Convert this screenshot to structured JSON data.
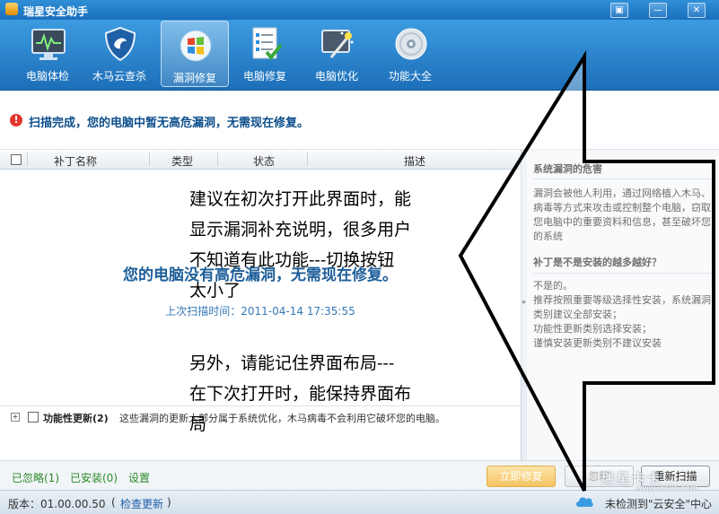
{
  "window": {
    "title": "瑞星安全助手",
    "controls": [
      "▣",
      "—",
      "✕"
    ]
  },
  "toolbar": {
    "items": [
      {
        "label": "电脑体检",
        "icon": "monitor-check-icon"
      },
      {
        "label": "木马云查杀",
        "icon": "shield-icon"
      },
      {
        "label": "漏洞修复",
        "icon": "windows-icon",
        "active": true
      },
      {
        "label": "电脑修复",
        "icon": "checklist-icon"
      },
      {
        "label": "电脑优化",
        "icon": "magic-wand-icon"
      },
      {
        "label": "功能大全",
        "icon": "disc-icon"
      }
    ]
  },
  "notice": {
    "text": "扫描完成，您的电脑中暂无高危漏洞，无需现在修复。"
  },
  "table": {
    "headers": [
      "补丁名称",
      "类型",
      "状态",
      "描述"
    ],
    "empty_message": "您的电脑没有高危漏洞，无需现在修复。",
    "last_scan": "上次扫描时间：2011-04-14 17:35:55"
  },
  "functional_row": {
    "name": "功能性更新(2)",
    "desc": "这些漏洞的更新大部分属于系统优化，木马病毒不会利用它破坏您的电脑。"
  },
  "side_panel": {
    "heading1": "系统漏洞的危害",
    "para1": "漏洞会被他人利用，通过网络植入木马、病毒等方式来攻击或控制整个电脑，窃取您电脑中的重要资料和信息，甚至破坏您的系统",
    "heading2": "补丁是不是安装的越多越好？",
    "answer": "不是的。",
    "lines": [
      "推荐按照重要等级选择性安装，系统漏洞类别建议全部安装；",
      "功能性更新类别选择安装；",
      "谨慎安装更新类别不建议安装"
    ]
  },
  "bottom": {
    "ignored": "已忽略(1)",
    "installed": "已安装(0)",
    "settings": "设置",
    "fix_button": "立即修复",
    "ignore_button": "忽略",
    "rescan_button": "重新扫描"
  },
  "status": {
    "version": "版本：01.00.00.50",
    "check_update": "检查更新",
    "paren_open": "(",
    "paren_close": ")",
    "cloud_text": "未检测到\"云安全\"中心"
  },
  "watermark": {
    "brand": "瑞星卡卡",
    "url": "www.ikaka.com"
  },
  "annotation": {
    "lines1": [
      "建议在初次打开此界面时，能",
      "显示漏洞补充说明，很多用户",
      "不知道有此功能---切换按钮",
      "太小了"
    ],
    "lines2": [
      "另外，请能记住界面布局---",
      "在下次打开时，能保持界面布",
      "局"
    ]
  },
  "colors": {
    "accent": "#1c6fb8",
    "warning": "#e2352b",
    "link_green": "#2c8a2c"
  }
}
